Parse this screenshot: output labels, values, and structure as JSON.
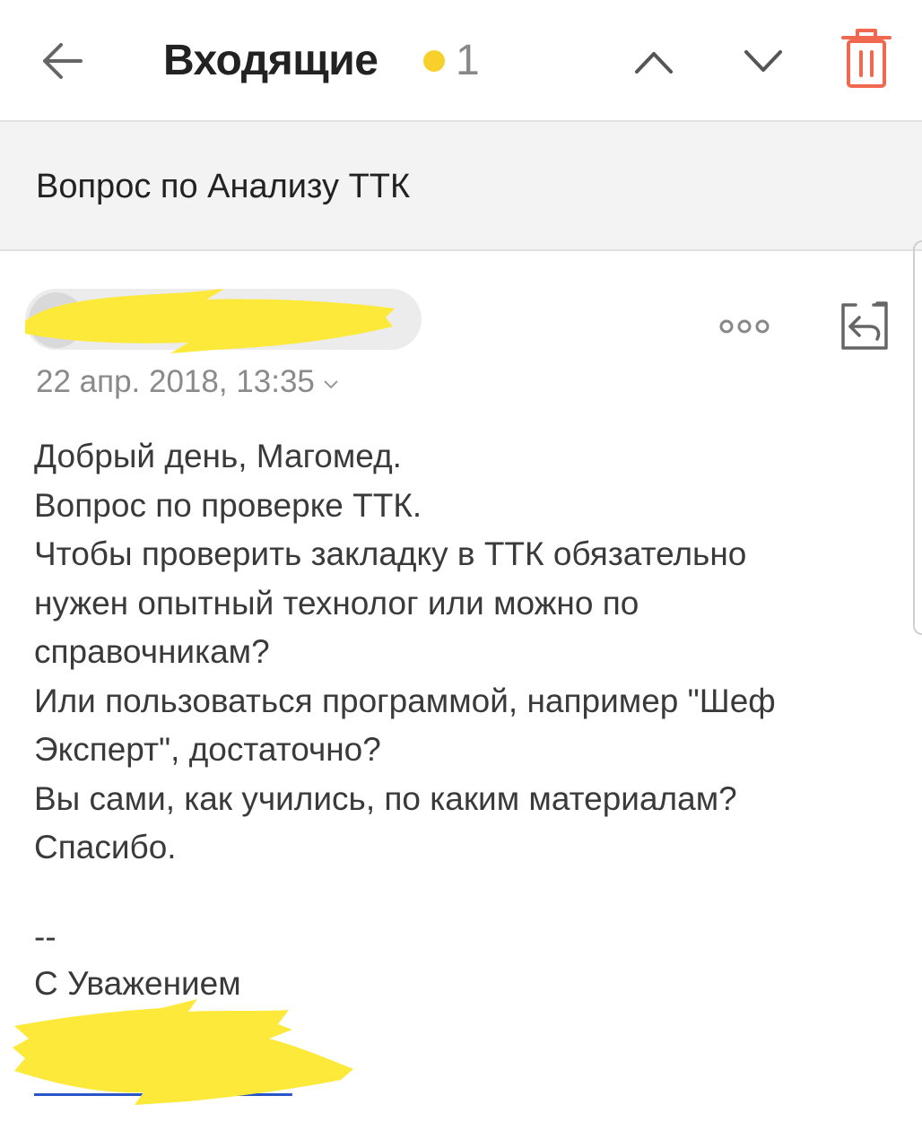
{
  "toolbar": {
    "folder_title": "Входящие",
    "unread_count": "1",
    "accent_color": "#f7d02c",
    "trash_color": "#f0684f",
    "icons": [
      "arrow-left-icon",
      "chevron-up-icon",
      "chevron-down-icon",
      "trash-icon"
    ]
  },
  "message": {
    "subject": "Вопрос по Анализу ТТК",
    "date": "22 апр. 2018, 13:35",
    "body_lines": [
      "Добрый день, Магомед.",
      "Вопрос по проверке ТТК.",
      "Чтобы проверить закладку в ТТК обязательно",
      "нужен опытный технолог или можно по",
      "справочникам?",
      "Или пользоваться программой, например \"Шеф",
      "Эксперт\", достаточно?",
      "Вы сами, как учились, по каким материалам?",
      "Спасибо."
    ],
    "signature": {
      "dash": "--",
      "regards": "С Уважением"
    },
    "icons": [
      "more-icon",
      "reply-icon"
    ],
    "redaction_color": "#fde93a"
  }
}
